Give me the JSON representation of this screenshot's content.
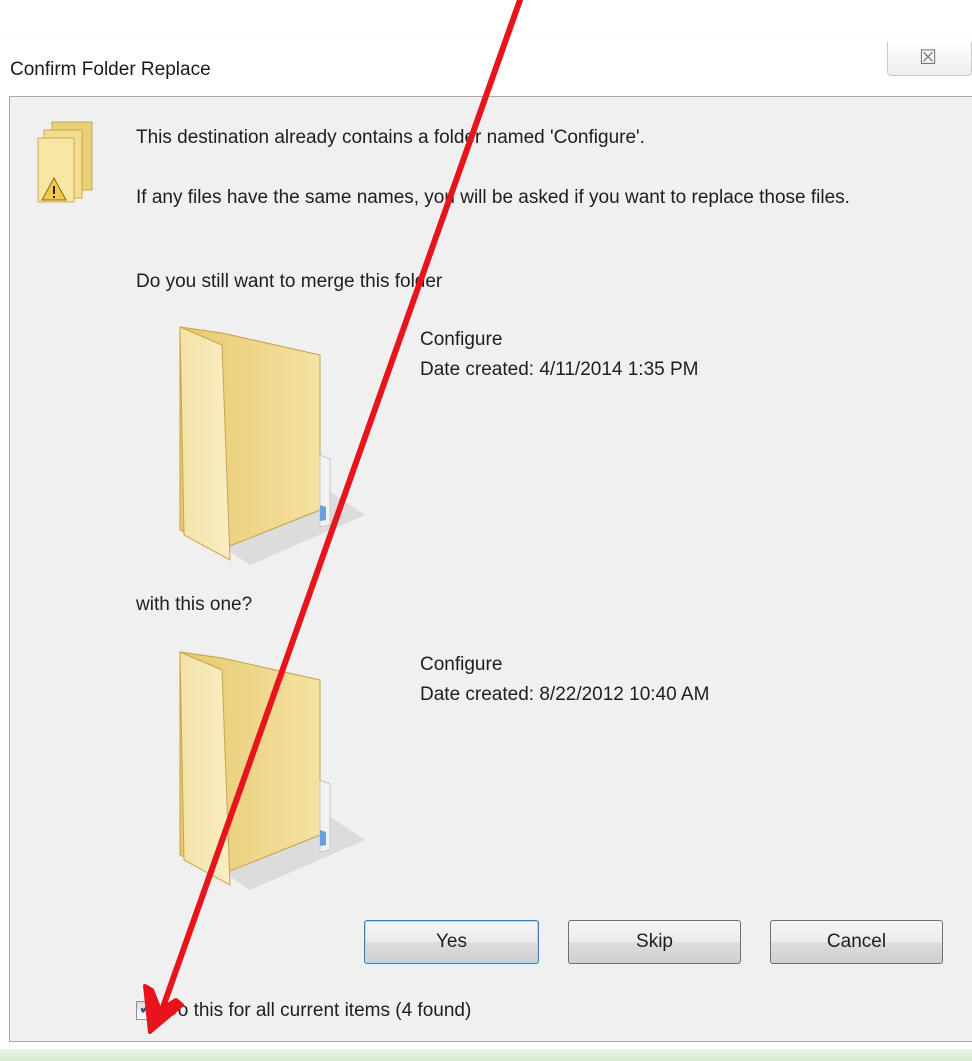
{
  "dialog": {
    "title": "Confirm Folder Replace",
    "close_glyph": "☒",
    "message_exists": "This destination already contains a folder named 'Configure'.",
    "message_replace": "If any files have the same names, you will be asked if you want to replace those files.",
    "question_merge": "Do you still want to merge this folder",
    "with_this_one": "with this one?",
    "existing_folder": {
      "name": "Configure",
      "date_created": "Date created: 4/11/2014 1:35 PM"
    },
    "new_folder": {
      "name": "Configure",
      "date_created": "Date created: 8/22/2012 10:40 AM"
    },
    "buttons": {
      "yes": "Yes",
      "skip": "Skip",
      "cancel": "Cancel"
    },
    "checkbox": {
      "label": "Do this for all current items (4 found)",
      "checked": true
    }
  },
  "icons": {
    "warning_folder": "folder-warning-icon",
    "folder": "folder-icon",
    "close": "close-icon",
    "check": "check-icon"
  },
  "annotation": {
    "arrow_color": "#e8141b"
  }
}
